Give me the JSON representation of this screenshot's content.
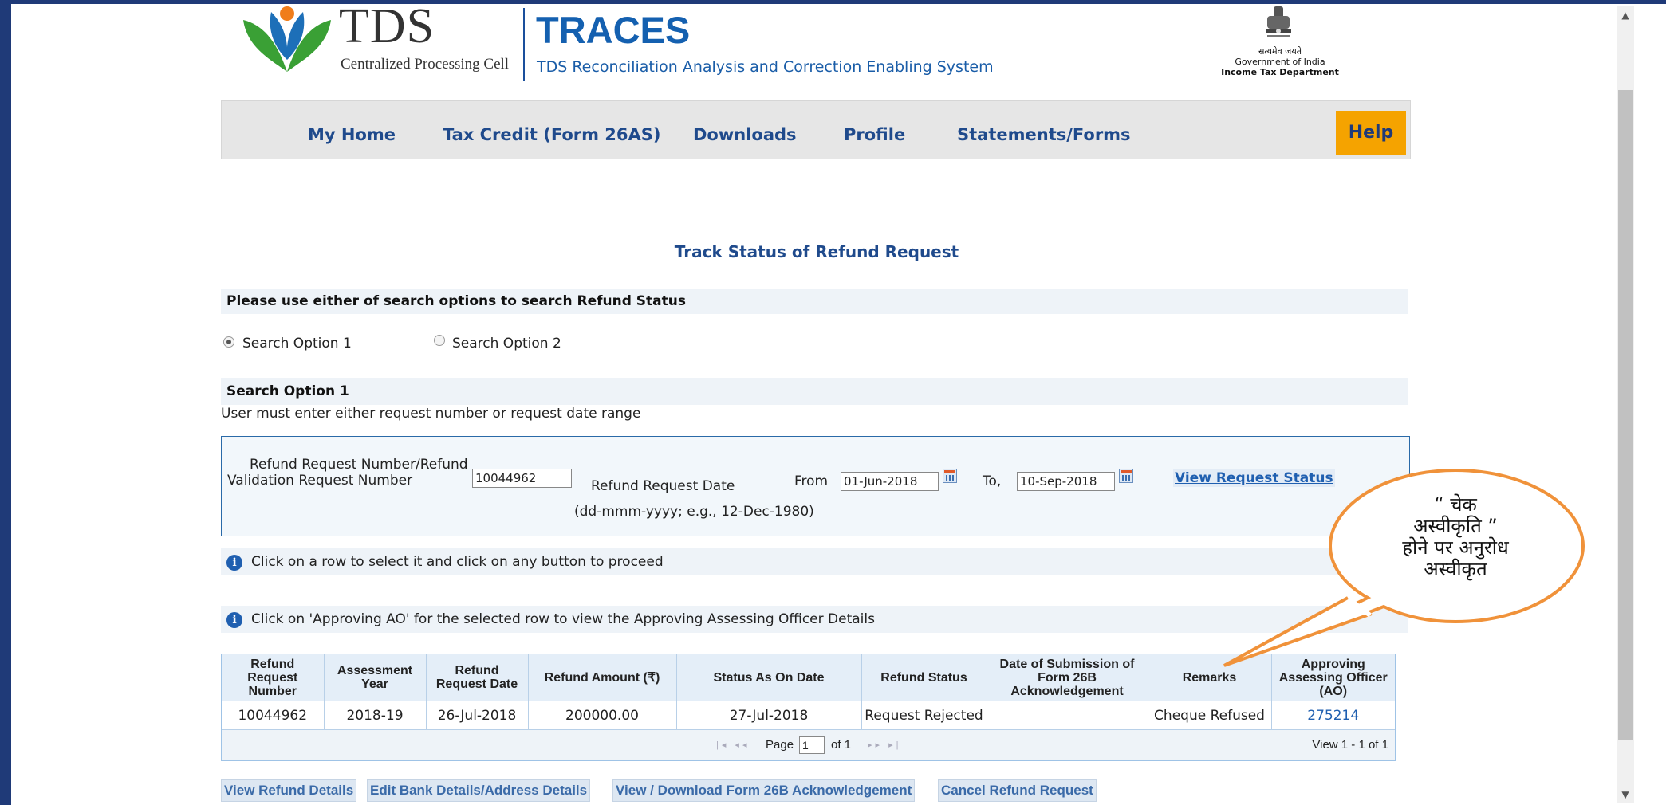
{
  "header": {
    "logo_title": "TDS",
    "logo_subtitle": "Centralized Processing Cell",
    "app_title": "TRACES",
    "app_subtitle": "TDS Reconciliation Analysis and Correction Enabling System",
    "emblem_motto": "सत्यमेव जयते",
    "emblem_gov": "Government of India",
    "emblem_dept": "Income Tax Department"
  },
  "nav": {
    "items": [
      "My Home",
      "Tax Credit (Form 26AS)",
      "Downloads",
      "Profile",
      "Statements/Forms"
    ],
    "help": "Help"
  },
  "page": {
    "title": "Track Status of Refund Request",
    "search_hint": "Please use either of search options to search Refund Status",
    "option1_label": "Search Option 1",
    "option2_label": "Search Option 2",
    "section_title": "Search Option 1",
    "section_note": "User must enter either request number or request date range"
  },
  "form": {
    "request_number_label": "Refund Request Number/Refund Validation Request Number",
    "request_number_value": "10044962",
    "date_label": "Refund Request Date",
    "date_format_hint": "(dd-mmm-yyyy; e.g., 12-Dec-1980)",
    "from_label": "From",
    "from_value": "01-Jun-2018",
    "to_label": "To,",
    "to_value": "10-Sep-2018",
    "view_status_link": "View Request Status"
  },
  "info": {
    "row_select": "Click on a row to select it and click on any button to proceed",
    "approving_ao": "Click on 'Approving AO' for the selected row to view the Approving Assessing Officer Details"
  },
  "table": {
    "headers": [
      "Refund Request Number",
      "Assessment Year",
      "Refund Request Date",
      "Refund Amount (₹)",
      "Status As On Date",
      "Refund Status",
      "Date of Submission of Form 26B Acknowledgement",
      "Remarks",
      "Approving Assessing Officer (AO)"
    ],
    "rows": [
      [
        "10044962",
        "2018-19",
        "26-Jul-2018",
        "200000.00",
        "27-Jul-2018",
        "Request Rejected",
        "",
        "Cheque Refused",
        "275214"
      ]
    ],
    "pager": {
      "page_label": "Page",
      "page_value": "1",
      "of_label": "of 1",
      "view_label": "View 1 - 1 of 1"
    }
  },
  "buttons": {
    "view_refund": "View Refund Details",
    "edit_bank": "Edit Bank Details/Address Details",
    "download_26b": "View / Download Form 26B Acknowledgement",
    "cancel_refund": "Cancel Refund Request"
  },
  "callout": {
    "line1": "“ चेक",
    "line2": "अस्वीकृति ”",
    "line3": "होने पर अनुरोध",
    "line4": "अस्वीकृत"
  },
  "colors": {
    "nav_text": "#1f4a8c",
    "help_bg": "#f5a300",
    "callout_stroke": "#f0923a",
    "frame": "#1f3a78"
  }
}
